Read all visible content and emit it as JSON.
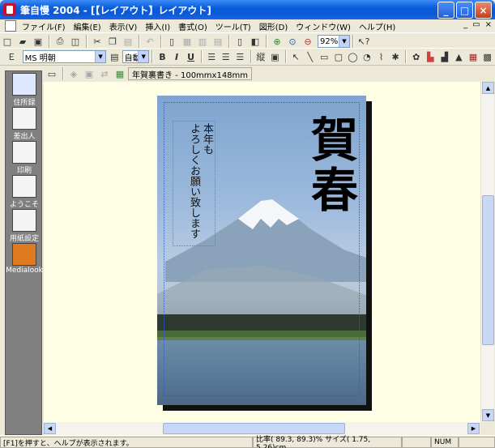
{
  "window": {
    "title": "筆自慢 2004 - [【レイアウト】レイアウト]"
  },
  "menu": [
    "ファイル(F)",
    "編集(E)",
    "表示(V)",
    "挿入(I)",
    "書式(O)",
    "ツール(T)",
    "図形(D)",
    "ウィンドウ(W)",
    "ヘルプ(H)"
  ],
  "toolbar1": {
    "zoom": "92%"
  },
  "toolbar2": {
    "font": "MS 明朝",
    "size": "自動",
    "bold": "B",
    "italic": "I",
    "underline": "U",
    "vertical": "縦"
  },
  "sidebar": [
    {
      "label": "住所録",
      "icon": "address-book-icon"
    },
    {
      "label": "差出人",
      "icon": "sender-icon"
    },
    {
      "label": "印刷",
      "icon": "printer-icon"
    },
    {
      "label": "ようこそ",
      "icon": "welcome-icon"
    },
    {
      "label": "用紙設定",
      "icon": "paper-setup-icon"
    },
    {
      "label": "Medialook",
      "icon": "medialook-icon"
    }
  ],
  "subbar": {
    "label": "年賀裏書き - 100mmx148mm"
  },
  "card": {
    "text_col1": "本年も",
    "text_col2": "よろしくお願い致します",
    "greeting": "賀春"
  },
  "status": {
    "help": "[F1]を押すと、ヘルプが表示されます。",
    "info": "比率( 89.3, 89.3)% サイズ( 1.75, 5.26)cm",
    "num": "NUM"
  },
  "colors": {
    "titlebar": "#0a5ddc",
    "canvas": "#ffffe6",
    "sidebar": "#808080"
  }
}
